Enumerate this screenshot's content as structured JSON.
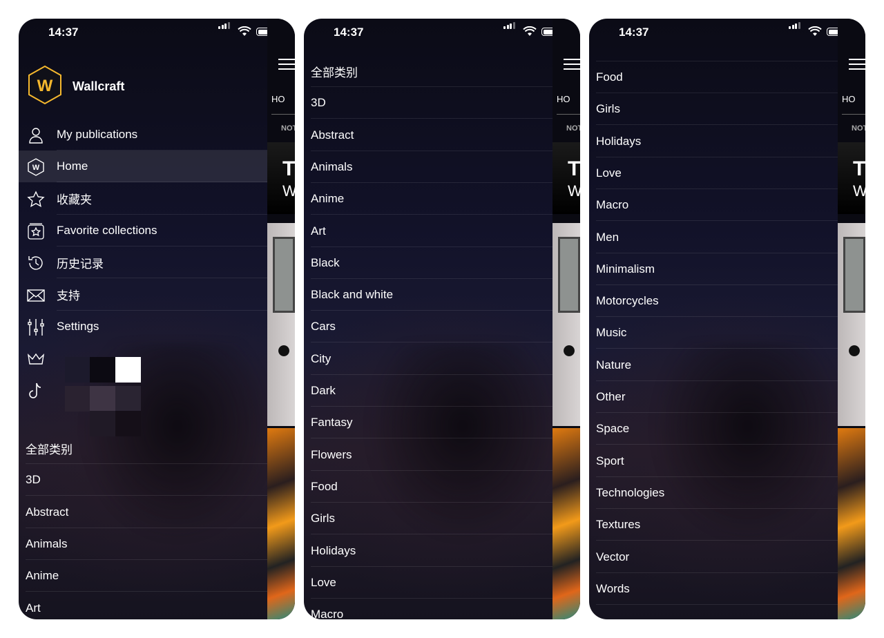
{
  "status": {
    "time": "14:37"
  },
  "brand": {
    "name": "Wallcraft",
    "logo_letter": "W",
    "accent": "#f5b82e"
  },
  "menu": [
    {
      "label": "My publications",
      "icon": "user-icon"
    },
    {
      "label": "Home",
      "icon": "wallcraft-icon",
      "active": true
    },
    {
      "label": "收藏夹",
      "icon": "star-icon"
    },
    {
      "label": "Favorite collections",
      "icon": "star-collection-icon"
    },
    {
      "label": "历史记录",
      "icon": "history-icon"
    },
    {
      "label": "支持",
      "icon": "mail-icon"
    },
    {
      "label": "Settings",
      "icon": "sliders-icon"
    },
    {
      "label": "",
      "icon": "crown-icon"
    },
    {
      "label": "",
      "icon": "tiktok-icon"
    }
  ],
  "app_behind": {
    "tab": "HO",
    "subtab": "NOT",
    "card_line1": "T",
    "card_line2": "W"
  },
  "phone1_categories": [
    "全部类别",
    "3D",
    "Abstract",
    "Animals",
    "Anime",
    "Art"
  ],
  "phone2_categories": [
    "全部类别",
    "3D",
    "Abstract",
    "Animals",
    "Anime",
    "Art",
    "Black",
    "Black and white",
    "Cars",
    "City",
    "Dark",
    "Fantasy",
    "Flowers",
    "Food",
    "Girls",
    "Holidays",
    "Love",
    "Macro"
  ],
  "phone3_categories": [
    "Food",
    "Girls",
    "Holidays",
    "Love",
    "Macro",
    "Men",
    "Minimalism",
    "Motorcycles",
    "Music",
    "Nature",
    "Other",
    "Space",
    "Sport",
    "Technologies",
    "Textures",
    "Vector",
    "Words"
  ]
}
